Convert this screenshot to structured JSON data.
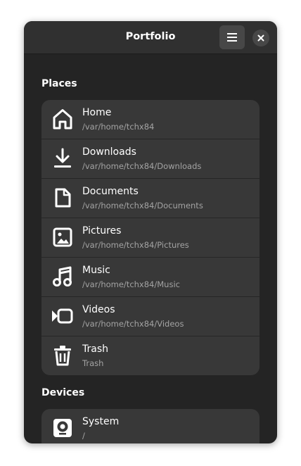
{
  "header": {
    "title": "Portfolio",
    "menu_icon": "hamburger-menu-icon",
    "close_icon": "close-icon"
  },
  "places": {
    "title": "Places",
    "items": [
      {
        "name": "Home",
        "path": "/var/home/tchx84",
        "icon": "home-icon"
      },
      {
        "name": "Downloads",
        "path": "/var/home/tchx84/Downloads",
        "icon": "download-icon"
      },
      {
        "name": "Documents",
        "path": "/var/home/tchx84/Documents",
        "icon": "document-icon"
      },
      {
        "name": "Pictures",
        "path": "/var/home/tchx84/Pictures",
        "icon": "picture-icon"
      },
      {
        "name": "Music",
        "path": "/var/home/tchx84/Music",
        "icon": "music-icon"
      },
      {
        "name": "Videos",
        "path": "/var/home/tchx84/Videos",
        "icon": "video-icon"
      },
      {
        "name": "Trash",
        "path": "Trash",
        "icon": "trash-icon"
      }
    ]
  },
  "devices": {
    "title": "Devices",
    "items": [
      {
        "name": "System",
        "path": "/",
        "icon": "drive-icon"
      }
    ]
  },
  "colors": {
    "window_bg": "#242424",
    "header_bg": "#303030",
    "row_bg": "#383838",
    "text": "#ffffff",
    "subtext": "#a3a3a3"
  }
}
